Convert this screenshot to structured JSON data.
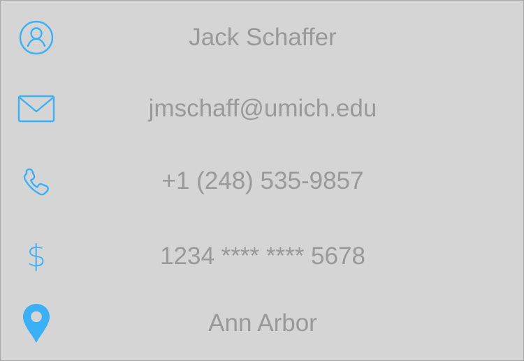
{
  "profile": {
    "accent_color": "#3ab1f6",
    "name": "Jack Schaffer",
    "email": "jmschaff@umich.edu",
    "phone": "+1 (248) 535-9857",
    "card": "1234 **** **** 5678",
    "location": "Ann Arbor"
  },
  "icons": {
    "name": "person-icon",
    "email": "mail-icon",
    "phone": "phone-icon",
    "card": "dollar-icon",
    "location": "location-pin-icon"
  }
}
